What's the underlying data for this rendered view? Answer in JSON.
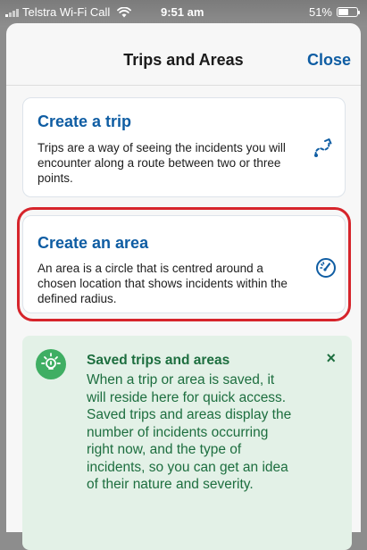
{
  "status_bar": {
    "carrier": "Telstra Wi-Fi Call",
    "time": "9:51 am",
    "battery": "51%",
    "icons": [
      "signal-icon",
      "wifi-icon",
      "battery-icon"
    ]
  },
  "header": {
    "title": "Trips and Areas",
    "close_label": "Close"
  },
  "cards": {
    "trip": {
      "title": "Create a trip",
      "description": "Trips are a way of seeing the incidents you will encounter along a route between two or three points.",
      "icon": "route-icon"
    },
    "area": {
      "title": "Create an area",
      "description": "An area is a circle that is centred around a chosen location that shows incidents within the defined radius.",
      "icon": "radius-gauge-icon"
    }
  },
  "info": {
    "icon": "lightbulb-icon",
    "title": "Saved trips and areas",
    "body": "When a trip or area is saved, it will reside here for quick access. Saved trips and areas display the number of incidents occurring right now, and the type of incidents, so you can get an idea of their nature and severity.",
    "dismiss_label": "×"
  },
  "colors": {
    "accent_blue": "#0f5da3",
    "highlight_red": "#d6242b",
    "info_green": "#1d6e3f",
    "info_background": "#e3f1e7",
    "icon_green": "#3fae63"
  }
}
